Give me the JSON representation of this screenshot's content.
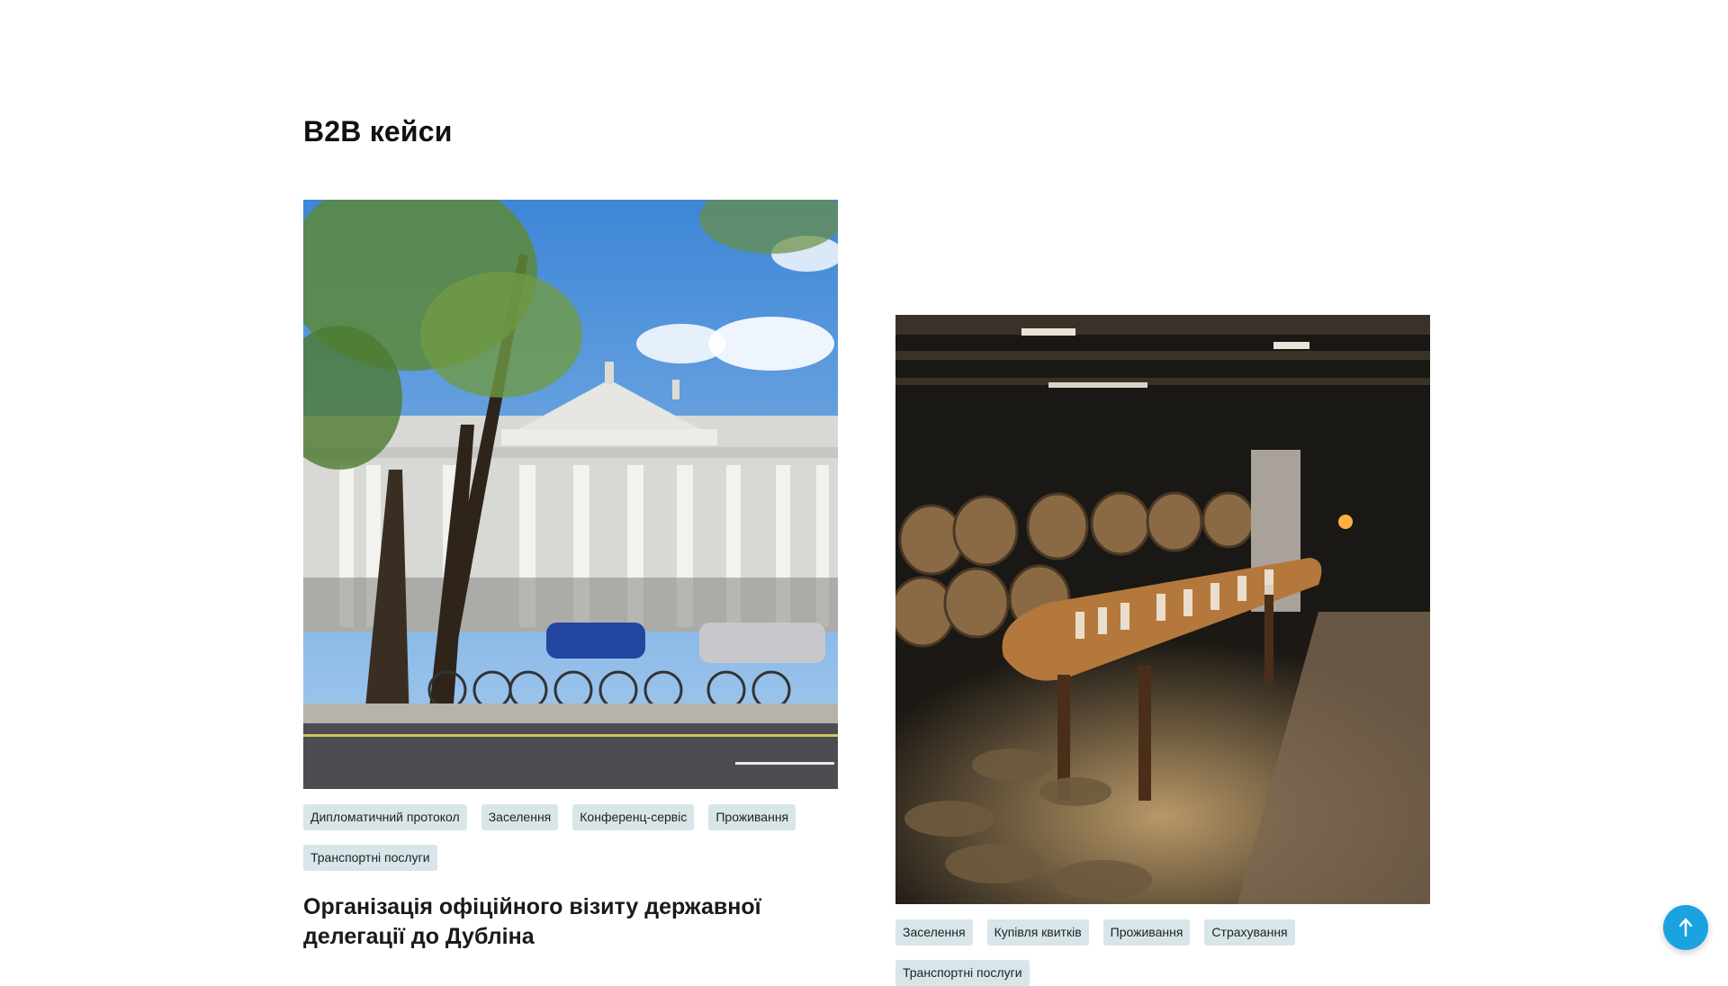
{
  "section": {
    "title": "B2B кейси"
  },
  "cases": [
    {
      "tags": [
        "Дипломатичний протокол",
        "Заселення",
        "Конференц-сервіс",
        "Проживання",
        "Транспортні послуги"
      ],
      "title": "Організація офіційного візиту державної делегації до Дубліна",
      "image_icon": "dublin-bank-building-photo"
    },
    {
      "tags": [
        "Заселення",
        "Купівля квитків",
        "Проживання",
        "Страхування",
        "Транспортні послуги"
      ],
      "title": "",
      "image_icon": "wine-cellar-tasting-photo"
    }
  ],
  "scroll_top": {
    "icon": "arrow-up-icon",
    "color": "#1aa3e0"
  }
}
